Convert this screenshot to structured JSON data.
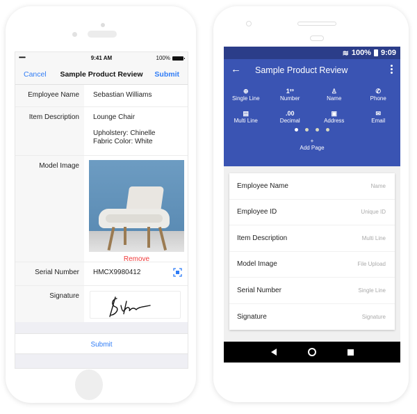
{
  "ios": {
    "status": {
      "signal": "•••••",
      "time": "9:41 AM",
      "battery": "100%"
    },
    "nav": {
      "cancel": "Cancel",
      "title": "Sample Product Review",
      "submit": "Submit"
    },
    "fields": {
      "employee_name": {
        "label": "Employee Name",
        "value": "Sebastian Williams"
      },
      "item_description": {
        "label": "Item Description",
        "line1": "Lounge Chair",
        "line2": "Upholstery: Chinelle",
        "line3": "Fabric Color: White"
      },
      "model_image": {
        "label": "Model Image",
        "remove": "Remove"
      },
      "serial_number": {
        "label": "Serial Number",
        "value": "HMCX9980412"
      },
      "signature": {
        "label": "Signature"
      }
    },
    "submit_button": "Submit"
  },
  "android": {
    "status": {
      "battery": "100%",
      "time": "9:09"
    },
    "toolbar": {
      "back": "←",
      "title": "Sample Product Review"
    },
    "tools": [
      {
        "icon": "⊕",
        "label": "Single Line"
      },
      {
        "icon": "1²³",
        "label": "Number"
      },
      {
        "icon": "♙",
        "label": "Name"
      },
      {
        "icon": "✆",
        "label": "Phone"
      },
      {
        "icon": "▤",
        "label": "Multi Line"
      },
      {
        "icon": ".00",
        "label": "Decimal"
      },
      {
        "icon": "▣",
        "label": "Address"
      },
      {
        "icon": "✉",
        "label": "Email"
      }
    ],
    "pages": {
      "current": 1,
      "total": 4
    },
    "add_page": {
      "icon": "+",
      "label": "Add Page"
    },
    "fields": [
      {
        "label": "Employee Name",
        "type": "Name"
      },
      {
        "label": "Employee ID",
        "type": "Unique ID"
      },
      {
        "label": "Item Description",
        "type": "Multi Line"
      },
      {
        "label": "Model Image",
        "type": "File Upload"
      },
      {
        "label": "Serial Number",
        "type": "Single Line"
      },
      {
        "label": "Signature",
        "type": "Signature"
      }
    ]
  },
  "colors": {
    "ios_accent": "#2f7cf6",
    "remove": "#f03a3a",
    "android_primary": "#3a54b3",
    "android_status": "#2b3d89"
  }
}
